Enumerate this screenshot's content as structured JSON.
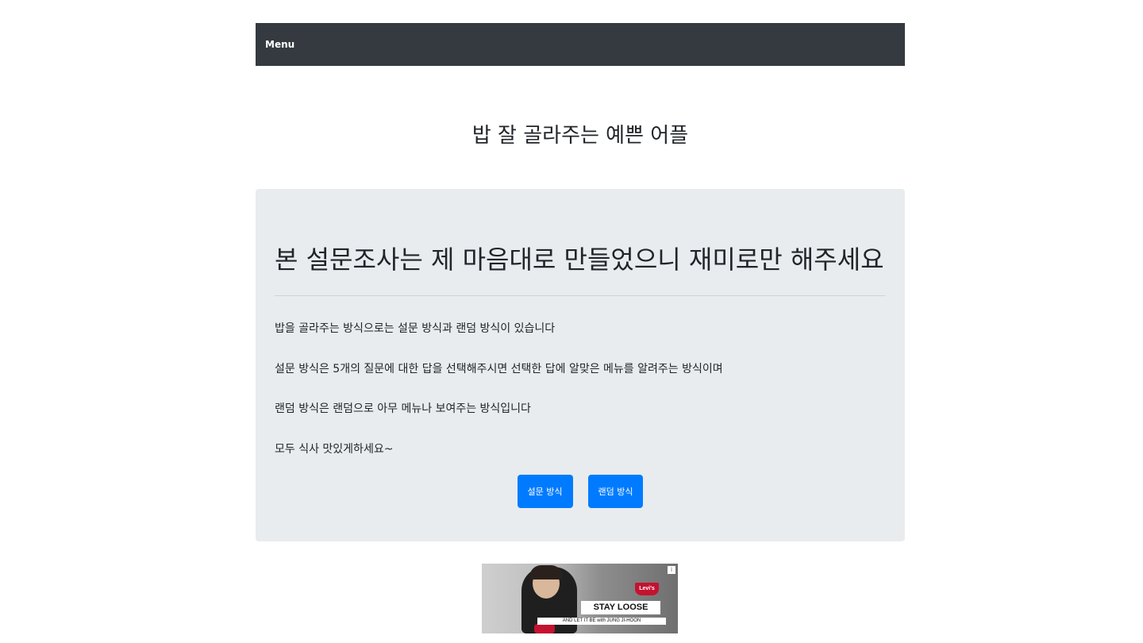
{
  "navbar": {
    "brand": "Menu"
  },
  "page_title": "밥 잘 골라주는 예쁜 어플",
  "jumbotron": {
    "heading": "본 설문조사는 제 마음대로 만들었으니 재미로만 해주세요",
    "paragraphs": [
      "밥을 골라주는 방식으로는 설문 방식과 랜덤 방식이 있습니다",
      "설문 방식은 5개의 질문에 대한 답을 선택해주시면 선택한 답에 알맞은 메뉴를 알려주는 방식이며",
      "랜덤 방식은 랜덤으로 아무 메뉴나 보여주는 방식입니다",
      "모두 식사 맛있게하세요~"
    ],
    "buttons": {
      "survey": "설문 방식",
      "random": "랜덤 방식"
    }
  },
  "ad": {
    "brand_logo": "Levi's",
    "headline": "STAY LOOSE",
    "subline": "AND LET IT BE with JUNG JI-HOON",
    "info_icon": "i"
  },
  "colors": {
    "navbar_bg": "#343a40",
    "jumbotron_bg": "#e9ecef",
    "primary_button": "#007bff",
    "brand_red": "#c41230"
  }
}
